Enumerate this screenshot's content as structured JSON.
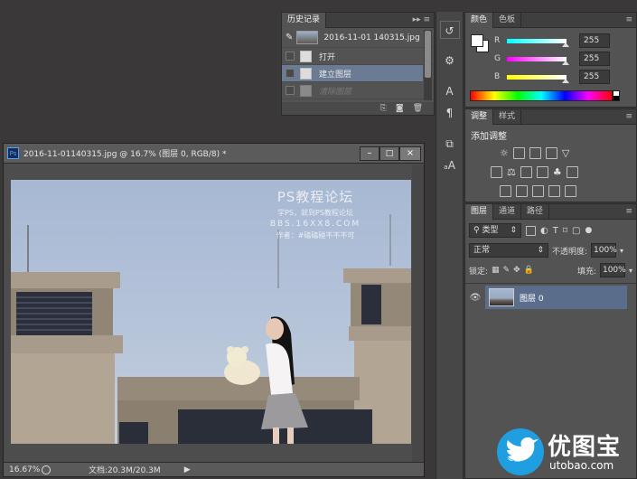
{
  "history": {
    "tab": "历史记录",
    "snapshot_label": "2016-11-01 140315.jpg",
    "items": [
      {
        "label": "打开",
        "state": "normal"
      },
      {
        "label": "建立图层",
        "state": "selected"
      },
      {
        "label": "清除图层",
        "state": "dimmed"
      }
    ]
  },
  "color": {
    "tabs": [
      "颜色",
      "色板"
    ],
    "channels": [
      {
        "name": "R",
        "value": "255",
        "gradient": "linear-gradient(90deg,#00ffff,#ffffff)"
      },
      {
        "name": "G",
        "value": "255",
        "gradient": "linear-gradient(90deg,#ff00ff,#ffffff)"
      },
      {
        "name": "B",
        "value": "255",
        "gradient": "linear-gradient(90deg,#ffff00,#ffffff)"
      }
    ]
  },
  "adjustments": {
    "tabs": [
      "调整",
      "样式"
    ],
    "heading": "添加调整"
  },
  "layers": {
    "tabs": [
      "图层",
      "通道",
      "路径"
    ],
    "filter_label": "类型",
    "blend_mode": "正常",
    "opacity_label": "不透明度:",
    "opacity_value": "100%",
    "lock_label": "锁定:",
    "fill_label": "填充:",
    "fill_value": "100%",
    "layer_name": "图层 0"
  },
  "document": {
    "title": "2016-11-01140315.jpg @ 16.7% (图层 0, RGB/8) *",
    "zoom": "16.67%",
    "doc_info": "文档:20.3M/20.3M",
    "watermark_title": "PS教程论坛",
    "watermark_line1": "学PS，就到PS教程论坛",
    "watermark_line2": "BBS.16XX8.COM",
    "watermark_line3": "作者：#磕磕碰不不不可"
  },
  "logo": {
    "cn": "优图宝",
    "url": "utobao.com"
  },
  "colors": {
    "panel_bg": "#535353",
    "selected_row": "#6b7b93",
    "layer_selected": "#5a6e8c"
  }
}
